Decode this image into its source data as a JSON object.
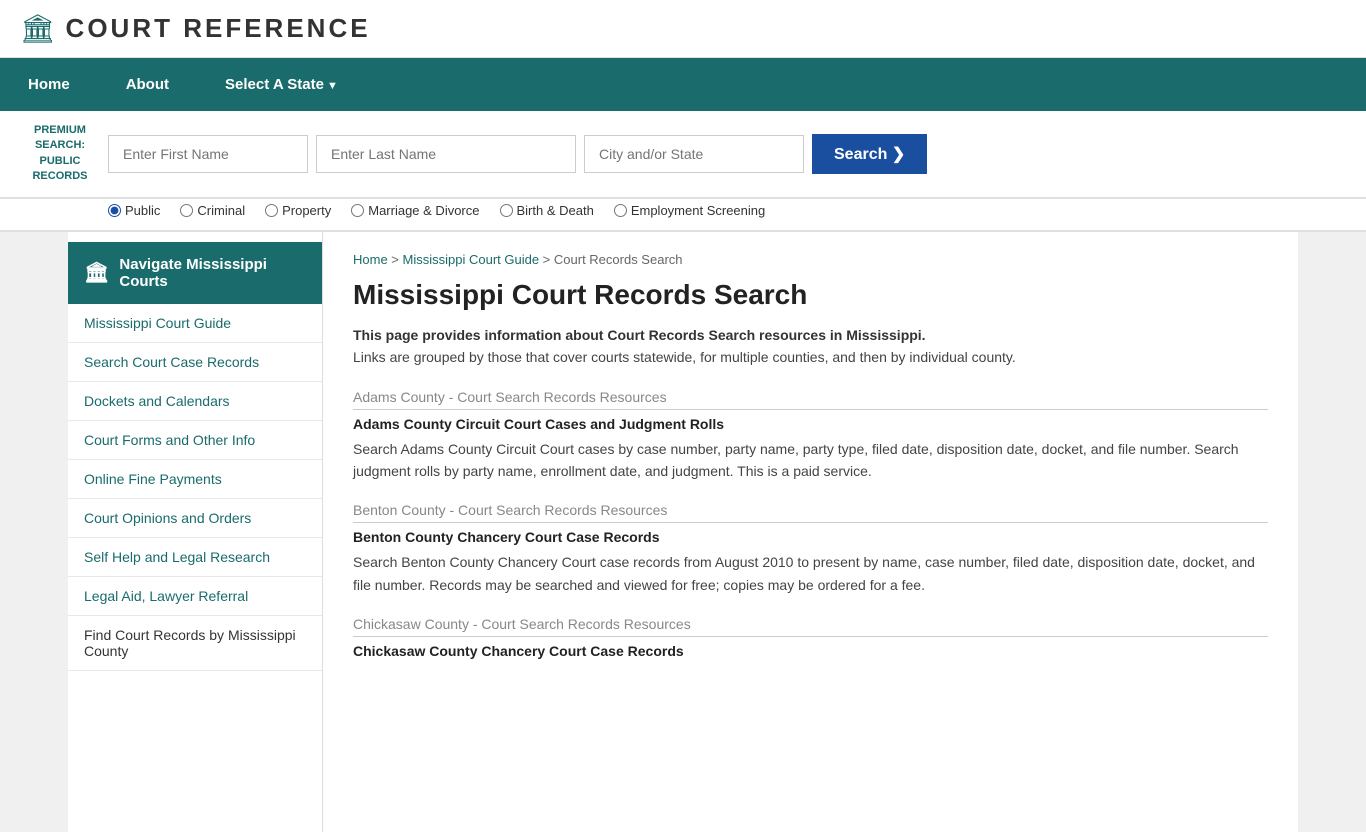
{
  "header": {
    "logo_icon": "🏛",
    "logo_text": "COURT REFERENCE"
  },
  "navbar": {
    "items": [
      {
        "label": "Home",
        "id": "home",
        "arrow": false
      },
      {
        "label": "About",
        "id": "about",
        "arrow": false
      },
      {
        "label": "Select A State",
        "id": "select-state",
        "arrow": true
      }
    ]
  },
  "search_bar": {
    "premium_label": "PREMIUM SEARCH: PUBLIC RECORDS",
    "first_name_placeholder": "Enter First Name",
    "last_name_placeholder": "Enter Last Name",
    "city_placeholder": "City and/or State",
    "button_label": "Search",
    "radio_options": [
      {
        "label": "Public",
        "value": "public",
        "checked": true
      },
      {
        "label": "Criminal",
        "value": "criminal",
        "checked": false
      },
      {
        "label": "Property",
        "value": "property",
        "checked": false
      },
      {
        "label": "Marriage & Divorce",
        "value": "marriage",
        "checked": false
      },
      {
        "label": "Birth & Death",
        "value": "birth",
        "checked": false
      },
      {
        "label": "Employment Screening",
        "value": "employment",
        "checked": false
      }
    ]
  },
  "breadcrumb": {
    "home": "Home",
    "guide": "Mississippi Court Guide",
    "current": "Court Records Search"
  },
  "page_title": "Mississippi Court Records Search",
  "intro": {
    "bold": "This page provides information about Court Records Search resources in Mississippi.",
    "normal": "Links are grouped by those that cover courts statewide, for multiple counties, and then by individual county."
  },
  "sidebar": {
    "nav_header": "Navigate Mississippi Courts",
    "nav_icon": "🏛",
    "links": [
      {
        "label": "Mississippi Court Guide",
        "id": "ms-court-guide"
      },
      {
        "label": "Search Court Case Records",
        "id": "search-records"
      },
      {
        "label": "Dockets and Calendars",
        "id": "dockets"
      },
      {
        "label": "Court Forms and Other Info",
        "id": "court-forms"
      },
      {
        "label": "Online Fine Payments",
        "id": "fine-payments"
      },
      {
        "label": "Court Opinions and Orders",
        "id": "opinions"
      },
      {
        "label": "Self Help and Legal Research",
        "id": "self-help"
      },
      {
        "label": "Legal Aid, Lawyer Referral",
        "id": "legal-aid"
      }
    ],
    "static_item": "Find Court Records by Mississippi County"
  },
  "counties": [
    {
      "name": "Adams County - Court Search Records Resources",
      "resources": [
        {
          "title": "Adams County Circuit Court Cases and Judgment Rolls",
          "description": "Search Adams County Circuit Court cases by case number, party name, party type, filed date, disposition date, docket, and file number. Search judgment rolls by party name, enrollment date, and judgment. This is a paid service."
        }
      ]
    },
    {
      "name": "Benton County - Court Search Records Resources",
      "resources": [
        {
          "title": "Benton County Chancery Court Case Records",
          "description": "Search Benton County Chancery Court case records from August 2010 to present by name, case number, filed date, disposition date, docket, and file number. Records may be searched and viewed for free; copies may be ordered for a fee."
        }
      ]
    },
    {
      "name": "Chickasaw County - Court Search Records Resources",
      "resources": [
        {
          "title": "Chickasaw County Chancery Court Case Records",
          "description": ""
        }
      ]
    }
  ]
}
